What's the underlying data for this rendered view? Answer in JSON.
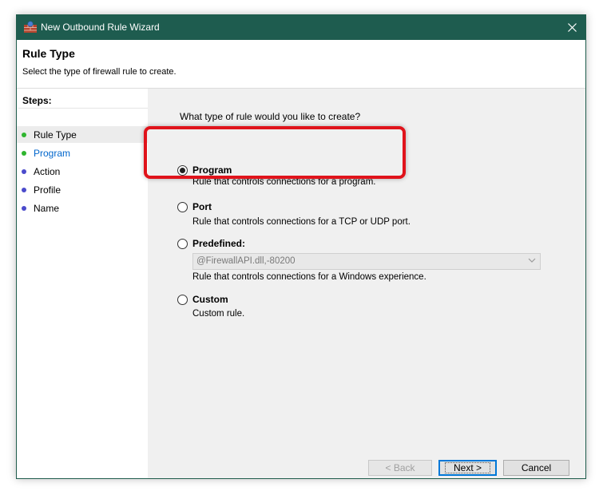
{
  "window": {
    "title": "New Outbound Rule Wizard"
  },
  "header": {
    "title": "Rule Type",
    "subtitle": "Select the type of firewall rule to create."
  },
  "steps": {
    "title": "Steps:",
    "items": [
      {
        "label": "Rule Type",
        "status": "complete"
      },
      {
        "label": "Program",
        "status": "complete"
      },
      {
        "label": "Action",
        "status": "pending"
      },
      {
        "label": "Profile",
        "status": "pending"
      },
      {
        "label": "Name",
        "status": "pending"
      }
    ]
  },
  "content": {
    "question": "What type of rule would you like to create?",
    "options": [
      {
        "label": "Program",
        "description": "Rule that controls connections for a program.",
        "selected": true
      },
      {
        "label": "Port",
        "description": "Rule that controls connections for a TCP or UDP port.",
        "selected": false
      },
      {
        "label": "Predefined:",
        "description": "Rule that controls connections for a Windows experience.",
        "selected": false
      },
      {
        "label": "Custom",
        "description": "Custom rule.",
        "selected": false
      }
    ],
    "predefined_select": {
      "value": "@FirewallAPI.dll,-80200",
      "disabled": true
    }
  },
  "buttons": {
    "back": "< Back",
    "next": "Next >",
    "cancel": "Cancel"
  },
  "colors": {
    "titlebar": "#1e5c4f",
    "step_complete": "#2fb52f",
    "step_pending": "#4b4bcc",
    "link": "#0066cc",
    "highlight": "#e0131b"
  }
}
